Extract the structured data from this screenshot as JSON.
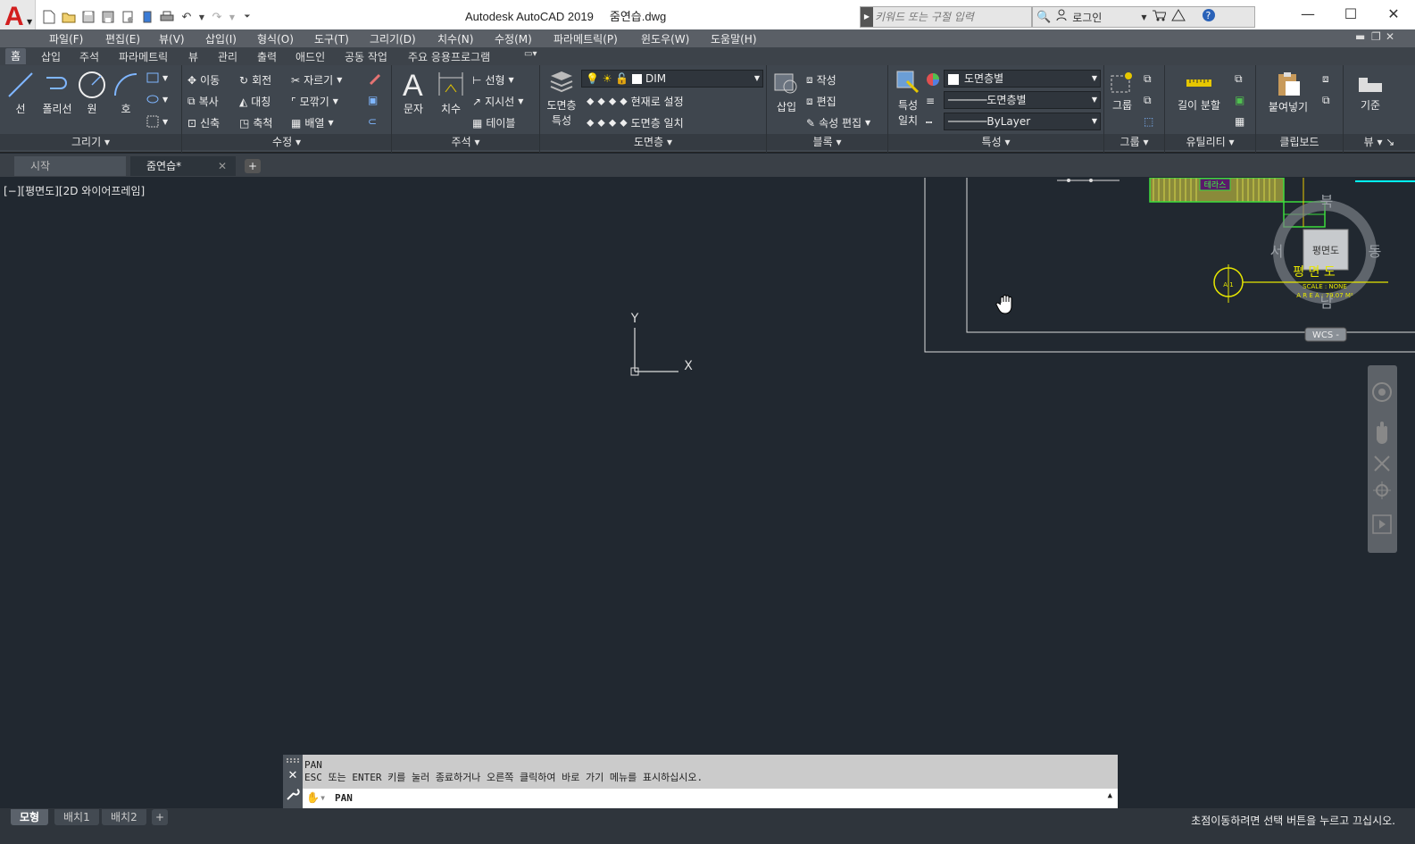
{
  "titlebar": {
    "app_title": "Autodesk AutoCAD 2019",
    "file_name": "줌연습.dwg",
    "search_placeholder": "키워드 또는 구절 입력",
    "login_label": "로그인"
  },
  "menu": {
    "items": [
      "파일(F)",
      "편집(E)",
      "뷰(V)",
      "삽입(I)",
      "형식(O)",
      "도구(T)",
      "그리기(D)",
      "치수(N)",
      "수정(M)",
      "파라메트릭(P)",
      "윈도우(W)",
      "도움말(H)"
    ]
  },
  "ribbon_tabs": [
    "홈",
    "삽입",
    "주석",
    "파라메트릭",
    "뷰",
    "관리",
    "출력",
    "애드인",
    "공동 작업",
    "주요 응용프로그램"
  ],
  "ribbon": {
    "draw": {
      "title": "그리기",
      "line": "선",
      "polyline": "폴리선",
      "circle": "원",
      "arc": "호"
    },
    "modify": {
      "title": "수정",
      "move": "이동",
      "rotate": "회전",
      "trim": "자르기",
      "copy": "복사",
      "mirror": "대칭",
      "fillet": "모깎기",
      "stretch": "신축",
      "scale": "축척",
      "array": "배열"
    },
    "annotation": {
      "title": "주석",
      "text": "문자",
      "dimension": "치수",
      "linear": "선형",
      "leader": "지시선",
      "table": "테이블"
    },
    "layers": {
      "title": "도면층",
      "properties_1": "도면층",
      "properties_2": "특성",
      "current_layer": "DIM",
      "set_current": "현재로 설정",
      "match": "도면층 일치"
    },
    "block": {
      "title": "블록",
      "insert": "삽입",
      "create": "작성",
      "edit": "편집",
      "edit_attr": "속성 편집"
    },
    "properties": {
      "title": "특성",
      "match_1": "특성",
      "match_2": "일치",
      "color": "도면층별",
      "linetype": "도면층별",
      "lineweight": "ByLayer"
    },
    "groups": {
      "title": "그룹",
      "group": "그룹"
    },
    "utilities": {
      "title": "유틸리티",
      "measure": "길이 분할"
    },
    "clipboard": {
      "title": "클립보드",
      "paste": "붙여넣기"
    },
    "view": {
      "title": "뷰",
      "base": "기준"
    }
  },
  "doc_tabs": {
    "start": "시작",
    "active": "줌연습*"
  },
  "viewport": {
    "label": "[−][평면도][2D 와이어프레임]",
    "ucs_x": "X",
    "ucs_y": "Y",
    "viewcube": {
      "north": "북",
      "south": "남",
      "east": "동",
      "west": "서",
      "face": "평면도",
      "wcs": "WCS -"
    },
    "drawing_labels": {
      "terrace": "테라스",
      "plan": "평 면 도",
      "scale": "SCALE : NONE",
      "area": "A R E A : 79.07 M²",
      "axis": "A 1"
    }
  },
  "command": {
    "history_1": "PAN",
    "history_2": "ESC 또는 ENTER 키를 눌러 종료하거나 오른쪽 클릭하여 바로 가기 메뉴를 표시하십시오.",
    "input": "PAN"
  },
  "layout_tabs": [
    "모형",
    "배치1",
    "배치2"
  ],
  "status_message": "초점이동하려면 선택 버튼을 누르고 끄십시오.",
  "colors": {
    "accent": "#d21e1e",
    "green": "#3cdc3c",
    "yellow": "#e6e600",
    "cyan": "#00ffff"
  }
}
